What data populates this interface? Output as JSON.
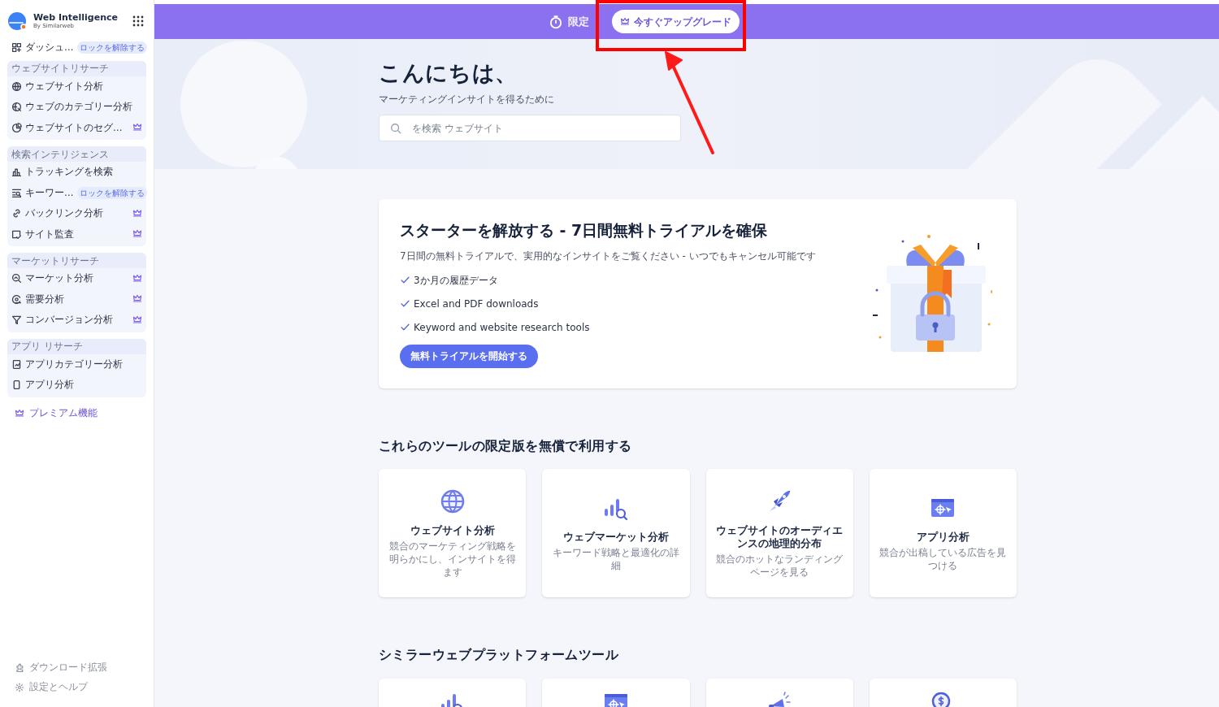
{
  "sidebar": {
    "brand_title": "Web Intelligence",
    "brand_subtitle": "By Similarweb",
    "top_items": [
      {
        "label": "ダッシュ…",
        "badge": "ロックを解除する",
        "premium": false
      }
    ],
    "groups": [
      {
        "heading": "ウェブサイトリサーチ",
        "items": [
          {
            "label": "ウェブサイト分析",
            "premium": false
          },
          {
            "label": "ウェブのカテゴリー分析",
            "premium": false
          },
          {
            "label": "ウェブサイトのセグ…",
            "premium": true
          }
        ]
      },
      {
        "heading": "検索インテリジェンス",
        "items": [
          {
            "label": "トラッキングを検索",
            "premium": false
          },
          {
            "label": "キーワー…",
            "badge": "ロックを解除する",
            "premium": false
          },
          {
            "label": "バックリンク分析",
            "premium": true
          },
          {
            "label": "サイト監査",
            "premium": true
          }
        ]
      },
      {
        "heading": "マーケットリサーチ",
        "items": [
          {
            "label": "マーケット分析",
            "premium": true
          },
          {
            "label": "需要分析",
            "premium": true
          },
          {
            "label": "コンバージョン分析",
            "premium": true
          }
        ]
      },
      {
        "heading": "アプリ リサーチ",
        "items": [
          {
            "label": "アプリカテゴリー分析",
            "premium": false
          },
          {
            "label": "アプリ分析",
            "premium": false
          }
        ]
      }
    ],
    "premium_link": "プレミアム機能",
    "footer_items": [
      "ダウンロード拡張",
      "設定とヘルプ"
    ]
  },
  "banner": {
    "edition": "限定",
    "upgrade_button": "今すぐアップグレード"
  },
  "hero": {
    "greeting": "こんにちは、",
    "subtitle": "マーケティングインサイトを得るために",
    "search": {
      "placeholder": "を検索 ウェブサイト"
    }
  },
  "trial": {
    "title": "スターターを解放する - 7日間無料トライアルを確保",
    "description": "7日間の無料トライアルで、実用的なインサイトをご覧ください - いつでもキャンセル可能です",
    "features": [
      "3か月の履歴データ",
      "Excel and PDF downloads",
      "Keyword and website research tools"
    ],
    "button": "無料トライアルを開始する"
  },
  "sections": [
    {
      "heading": "これらのツールの限定版を無償で利用する",
      "cards": [
        {
          "kind": "tool",
          "title": "ウェブサイト分析",
          "description": "競合のマーケティング戦略を明らかにし、インサイトを得ます"
        },
        {
          "kind": "tool",
          "title": "ウェブマーケット分析",
          "description": "キーワード戦略と最適化の詳細"
        },
        {
          "kind": "tool",
          "title": "ウェブサイトのオーディエンスの地理的分布",
          "description": "競合のホットなランディングページを見る"
        },
        {
          "kind": "tool",
          "title": "アプリ分析",
          "description": "競合が出稿している広告を見つける"
        }
      ]
    },
    {
      "heading": "シミラーウェブプラットフォームツール",
      "cards": [
        {
          "kind": "tool"
        },
        {
          "kind": "tool"
        },
        {
          "kind": "tool"
        },
        {
          "kind": "tool"
        }
      ]
    }
  ],
  "annotation": {
    "highlight": true,
    "arrow": true
  }
}
